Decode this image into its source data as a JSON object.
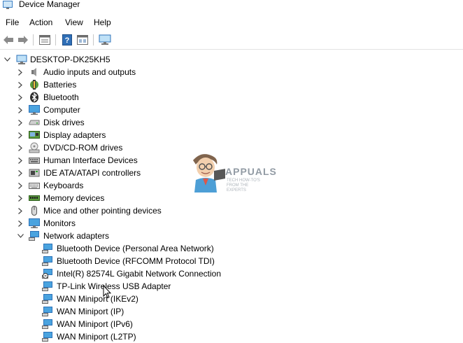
{
  "window": {
    "title": "Device Manager"
  },
  "menu": [
    "File",
    "Action",
    "View",
    "Help"
  ],
  "toolbar": {
    "buttons": [
      "back-arrow-icon",
      "forward-arrow-icon",
      "properties-icon",
      "help-icon",
      "show-hidden-icon",
      "monitor-icon"
    ]
  },
  "tree": {
    "root": "DESKTOP-DK25KH5",
    "categories": [
      {
        "label": "Audio inputs and outputs",
        "icon": "speaker-icon"
      },
      {
        "label": "Batteries",
        "icon": "battery-icon"
      },
      {
        "label": "Bluetooth",
        "icon": "bluetooth-icon"
      },
      {
        "label": "Computer",
        "icon": "computer-icon"
      },
      {
        "label": "Disk drives",
        "icon": "disk-drive-icon"
      },
      {
        "label": "Display adapters",
        "icon": "display-adapter-icon"
      },
      {
        "label": "DVD/CD-ROM drives",
        "icon": "dvd-drive-icon"
      },
      {
        "label": "Human Interface Devices",
        "icon": "hid-icon"
      },
      {
        "label": "IDE ATA/ATAPI controllers",
        "icon": "ide-controller-icon"
      },
      {
        "label": "Keyboards",
        "icon": "keyboard-icon"
      },
      {
        "label": "Memory devices",
        "icon": "memory-icon"
      },
      {
        "label": "Mice and other pointing devices",
        "icon": "mouse-icon"
      },
      {
        "label": "Monitors",
        "icon": "monitor-icon"
      },
      {
        "label": "Network adapters",
        "icon": "network-adapter-icon",
        "expanded": true
      }
    ],
    "network_adapters": [
      "Bluetooth Device (Personal Area Network)",
      "Bluetooth Device (RFCOMM Protocol TDI)",
      "Intel(R) 82574L Gigabit Network Connection",
      "TP-Link Wireless USB Adapter",
      "WAN Miniport (IKEv2)",
      "WAN Miniport (IP)",
      "WAN Miniport (IPv6)",
      "WAN Miniport (L2TP)"
    ]
  },
  "watermark": {
    "brand": "APPUALS",
    "tagline": "TECH HOW-TO'S FROM THE EXPERTS"
  }
}
